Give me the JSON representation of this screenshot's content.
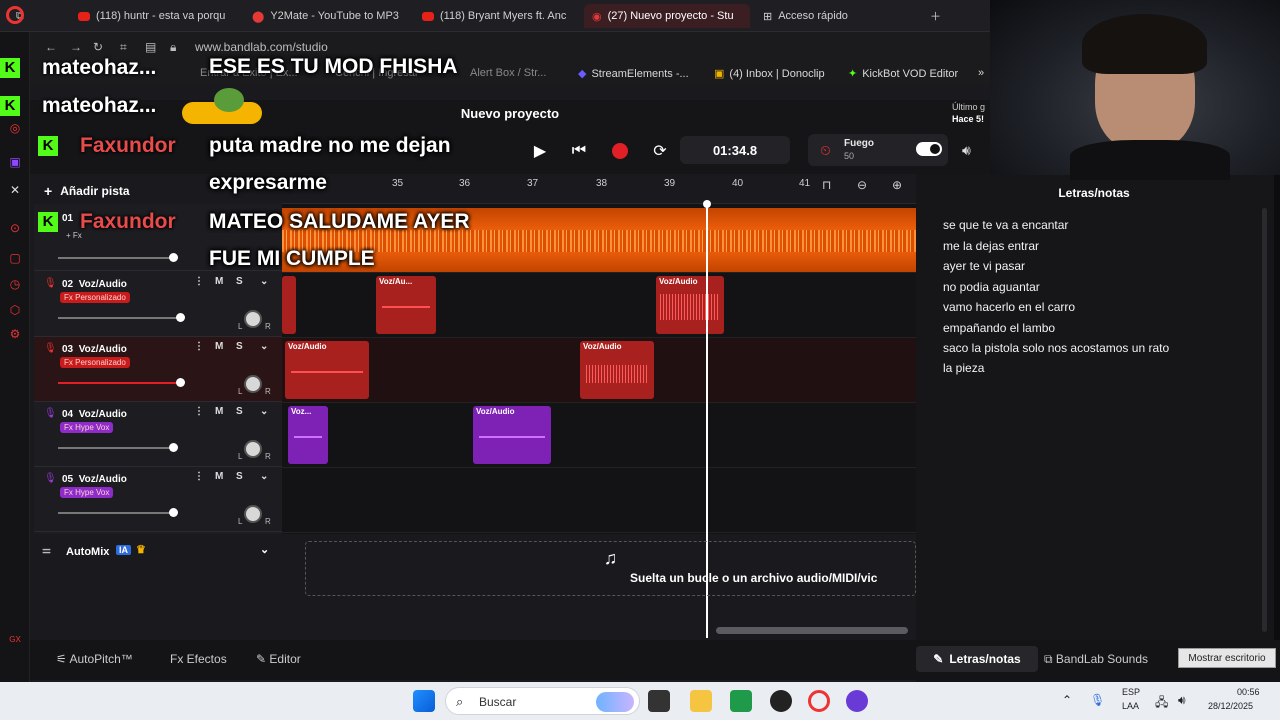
{
  "browser": {
    "tabs": [
      {
        "label": "(118) huntr - esta va porqu"
      },
      {
        "label": "Y2Mate - YouTube to MP3"
      },
      {
        "label": "(118) Bryant Myers ft. Anc"
      },
      {
        "label": "(27) Nuevo proyecto - Stu"
      },
      {
        "label": "Acceso rápido"
      }
    ],
    "url": "www.bandlab.com/studio",
    "bookmarks": [
      {
        "label": "StreamElements -..."
      },
      {
        "label": "(4) Inbox | Donoclip"
      },
      {
        "label": "KickBot VOD Editor"
      }
    ],
    "partial_bookmarks": [
      "Entrar a Exito | Ex...",
      "Cehchi | Ingresar",
      "Alert Box / Str..."
    ]
  },
  "studio": {
    "project_title": "Nuevo proyecto",
    "last_saved": "Último g",
    "last_saved_time": "Hace 5!",
    "time_display": "01:34.8",
    "fuego_label": "Fuego",
    "fuego_value": "50",
    "add_track": "Añadir pista",
    "ruler_marks": [
      "35",
      "36",
      "37",
      "38",
      "39",
      "40",
      "41"
    ],
    "tracks": [
      {
        "number": "01",
        "name": "",
        "fx": "+ Fx",
        "color": "#ff5a00",
        "volume": 0.78
      },
      {
        "number": "02",
        "name": "Voz/Audio",
        "fx": "Fx Personalizado",
        "color": "#b3231f",
        "volume": 0.85,
        "m": "M",
        "s": "S"
      },
      {
        "number": "03",
        "name": "Voz/Audio",
        "fx": "Fx Personalizado",
        "color": "#b3231f",
        "volume": 0.85,
        "m": "M",
        "s": "S"
      },
      {
        "number": "04",
        "name": "Voz/Audio",
        "fx": "Fx Hype Vox",
        "color": "#8e2cc9",
        "volume": 0.78,
        "m": "M",
        "s": "S"
      },
      {
        "number": "05",
        "name": "Voz/Audio",
        "fx": "Fx Hype Vox",
        "color": "#8e2cc9",
        "volume": 0.78,
        "m": "M",
        "s": "S"
      }
    ],
    "pan_left": "L",
    "pan_right": "R",
    "clips": [
      {
        "lane": 1,
        "label": "Voz/Au..."
      },
      {
        "lane": 1,
        "label": "Voz/Audio"
      },
      {
        "lane": 2,
        "label": "Voz/Audio"
      },
      {
        "lane": 2,
        "label": "Voz/Audio"
      },
      {
        "lane": 3,
        "label": "Voz..."
      },
      {
        "lane": 3,
        "label": "Voz/Audio"
      }
    ],
    "automix": {
      "label": "AutoMix",
      "badge": "IA"
    },
    "dropzone": "Suelta un bucle o un archivo audio/MIDI/vic",
    "bottom": {
      "autopitch": "AutoPitch™",
      "effects": "Efectos",
      "editor": "Editor"
    }
  },
  "lyrics_panel": {
    "title": "Letras/notas",
    "lines": [
      "se que te va a encantar",
      "me la dejas  entrar",
      "ayer te vi pasar",
      "no podia aguantar",
      "vamo hacerlo en el carro",
      "empañando el lambo",
      "saco la pistola solo nos acostamos un rato",
      "la pieza"
    ],
    "tab_lyrics": "Letras/notas",
    "tab_sounds": "BandLab Sounds",
    "desktop_button": "Mostrar escritorio"
  },
  "chat_overlay": [
    {
      "user": "mateohaz...",
      "message": "ESE ES TU MOD FHISHA"
    },
    {
      "user": "mateohaz...",
      "message": ""
    },
    {
      "user": "Faxundor",
      "message": "puta madre no me dejan expresarme"
    },
    {
      "user": "Faxundor",
      "message": "MATEO SALUDAME AYER FUE MI CUMPLE"
    }
  ],
  "chat_lines": {
    "l1": "puta madre no me dejan",
    "l2": "expresarme",
    "l3": "MATEO SALUDAME AYER",
    "l4": "FUE MI CUMPLE"
  },
  "taskbar": {
    "search_placeholder": "Buscar",
    "lang": "ESP",
    "lang_sub": "LAA",
    "time": "00:56",
    "date": "28/12/2025"
  },
  "colors": {
    "accent_red": "#e01f26",
    "orange_track": "#ff5a00",
    "purple_track": "#8e2cc9",
    "kick_green": "#53fc18"
  }
}
